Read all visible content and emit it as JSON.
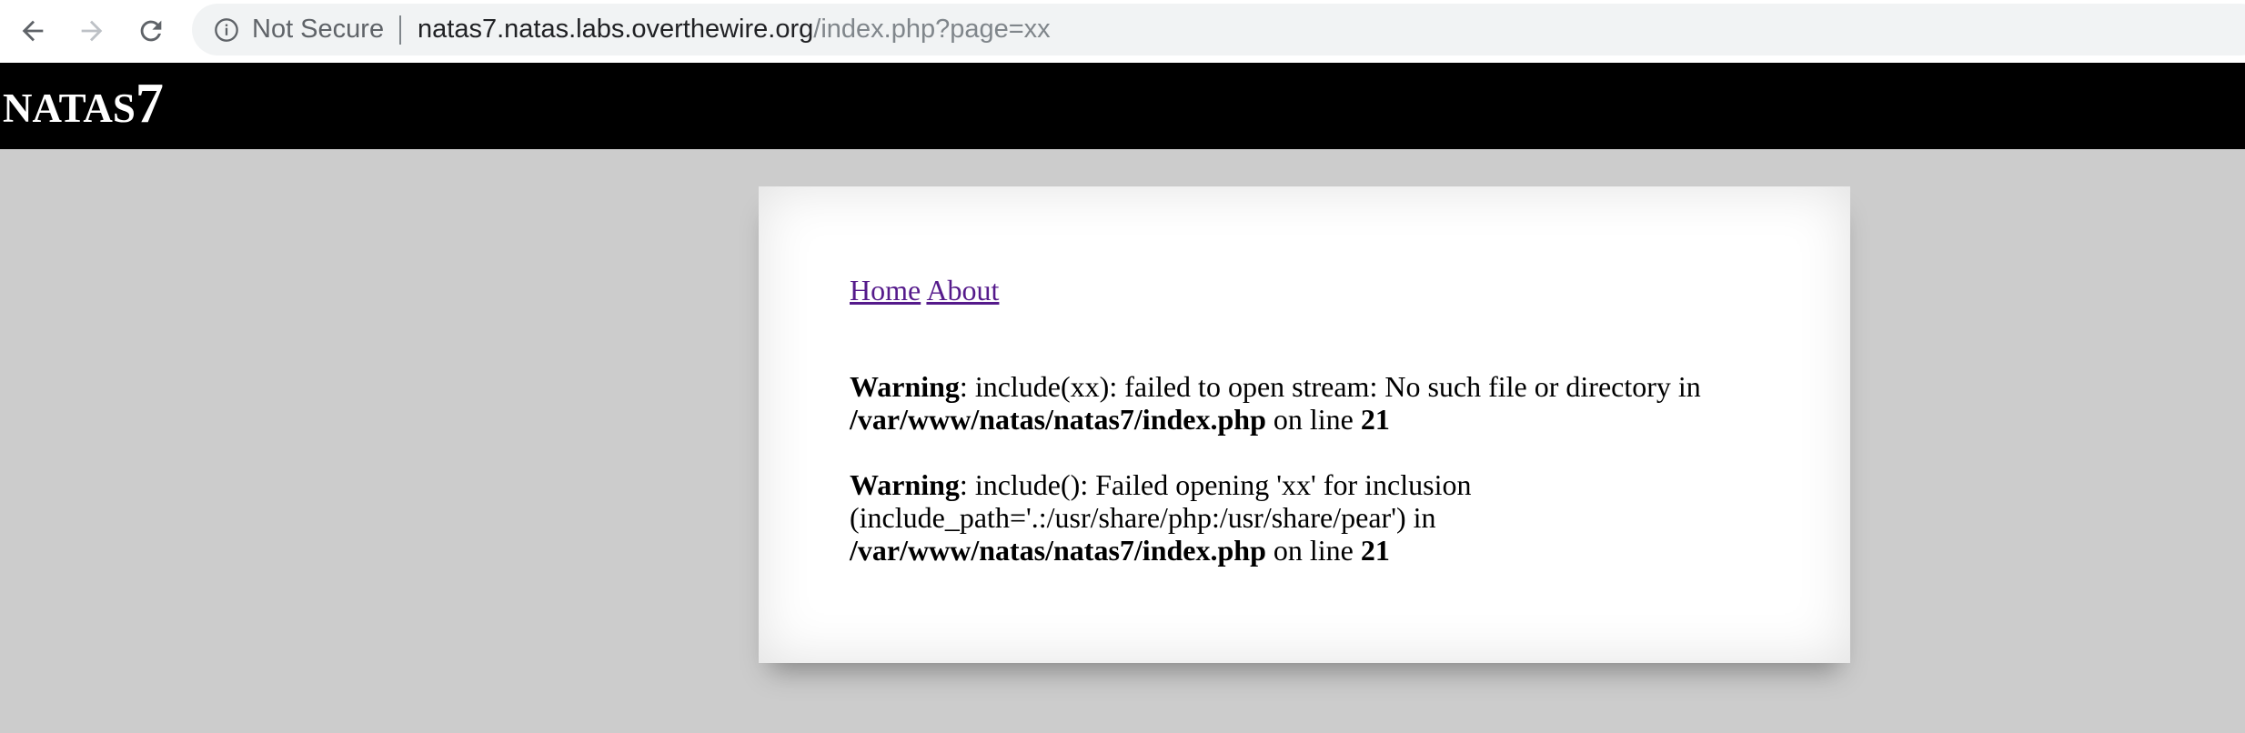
{
  "browser": {
    "security_label": "Not Secure",
    "url_host": "natas7.natas.labs.overthewire.org",
    "url_path": "/index.php?page=xx",
    "icons": {
      "back": "back-arrow-icon",
      "forward": "forward-arrow-icon",
      "reload": "reload-icon",
      "info": "info-icon"
    }
  },
  "header": {
    "title_prefix": "NATAS",
    "title_number": "7"
  },
  "nav": {
    "home": "Home",
    "about": "About"
  },
  "warnings": [
    {
      "label": "Warning",
      "message_1": ": include(xx): failed to open stream: No such file or directory in ",
      "path": "/var/www/natas/natas7/index.php",
      "on_line": " on line ",
      "line": "21"
    },
    {
      "label": "Warning",
      "message_1": ": include(): Failed opening 'xx' for inclusion (include_path='.:/usr/share/php:/usr/share/pear') in ",
      "path": "/var/www/natas/natas7/index.php",
      "on_line": " on line ",
      "line": "21"
    }
  ],
  "colors": {
    "page_background": "#cccccc",
    "header_background": "#000000",
    "link_visited": "#551a8b"
  }
}
